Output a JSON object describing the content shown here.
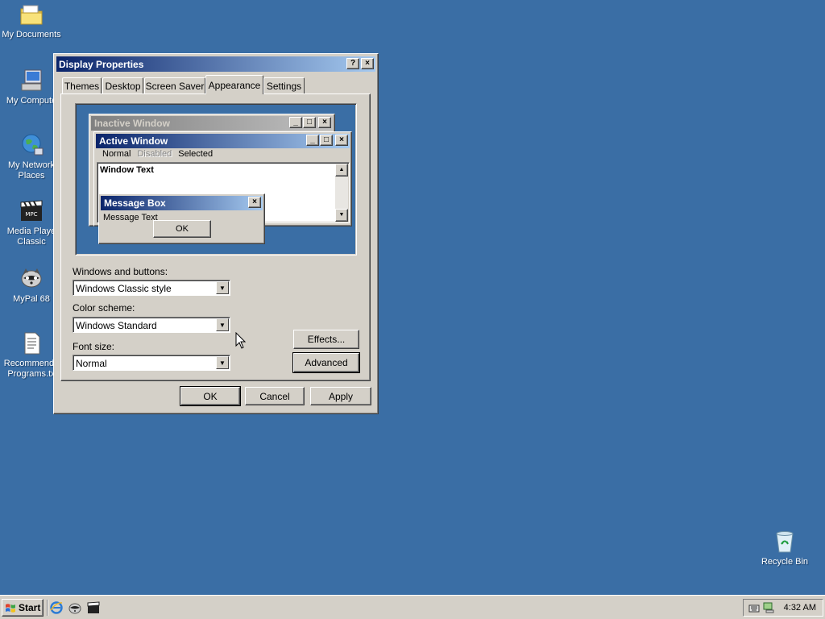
{
  "desktop": {
    "icons": [
      {
        "label": "My Documents"
      },
      {
        "label": "My Compute"
      },
      {
        "label": "My Network\nPlaces"
      },
      {
        "label": "Media Playe\nClassic"
      },
      {
        "label": "MyPal 68"
      },
      {
        "label": "Recommende\nPrograms.tx"
      },
      {
        "label": "Recycle Bin"
      }
    ]
  },
  "dialog": {
    "title": "Display Properties",
    "help_icon": "?",
    "close_icon": "×",
    "tabs": [
      "Themes",
      "Desktop",
      "Screen Saver",
      "Appearance",
      "Settings"
    ],
    "active_tab": "Appearance",
    "preview": {
      "inactive_title": "Inactive Window",
      "active_title": "Active Window",
      "menu": [
        "Normal",
        "Disabled",
        "Selected"
      ],
      "window_text": "Window Text",
      "msgbox_title": "Message Box",
      "msgbox_text": "Message Text",
      "msgbox_ok": "OK"
    },
    "windows_buttons_label": "Windows and buttons:",
    "windows_buttons_value": "Windows Classic style",
    "color_scheme_label": "Color scheme:",
    "color_scheme_value": "Windows Standard",
    "font_size_label": "Font size:",
    "font_size_value": "Normal",
    "effects_button": "Effects...",
    "advanced_button": "Advanced",
    "ok_button": "OK",
    "cancel_button": "Cancel",
    "apply_button": "Apply"
  },
  "taskbar": {
    "start_label": "Start",
    "clock": "4:32 AM"
  },
  "colors": {
    "desktop": "#3a6ea5",
    "title_active_start": "#0a246a",
    "title_active_end": "#a6caf0",
    "title_inactive": "#808080",
    "face": "#d4d0c8"
  }
}
